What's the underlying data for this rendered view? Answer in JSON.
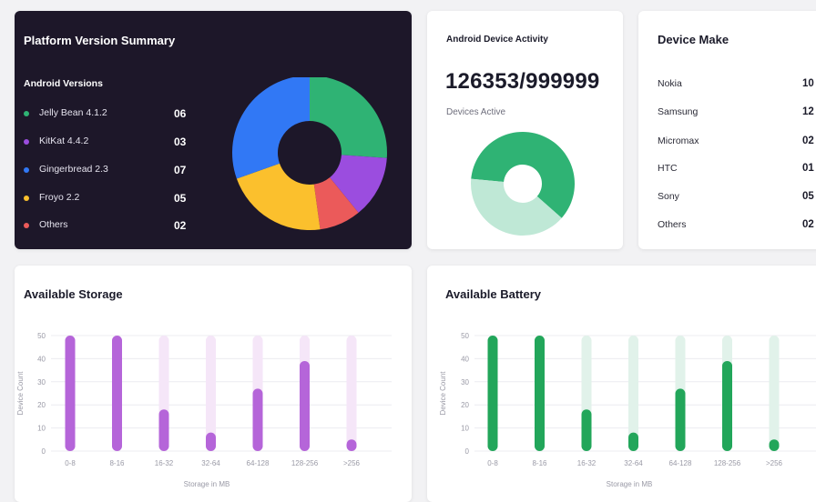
{
  "platform": {
    "title": "Platform Version Summary",
    "subtitle": "Android Versions",
    "items": [
      {
        "label": "Jelly Bean 4.1.2",
        "value": "06",
        "color": "#2fb374"
      },
      {
        "label": "KitKat 4.4.2",
        "value": "03",
        "color": "#9b4ddf"
      },
      {
        "label": "Gingerbread 2.3",
        "value": "07",
        "color": "#3178f5"
      },
      {
        "label": "Froyo 2.2",
        "value": "05",
        "color": "#fbc02d"
      },
      {
        "label": "Others",
        "value": "02",
        "color": "#eb5a5a"
      }
    ]
  },
  "activity": {
    "title": "Android Device Activity",
    "count": "126353/999999",
    "subtitle": "Devices Active",
    "active_fraction": 0.6,
    "colors": {
      "active": "#2fb374",
      "inactive": "#bfe8d6"
    }
  },
  "make": {
    "title": "Device Make",
    "items": [
      {
        "label": "Nokia",
        "value": "10"
      },
      {
        "label": "Samsung",
        "value": "12"
      },
      {
        "label": "Micromax",
        "value": "02"
      },
      {
        "label": "HTC",
        "value": "01"
      },
      {
        "label": "Sony",
        "value": "05"
      },
      {
        "label": "Others",
        "value": "02"
      }
    ]
  },
  "storage": {
    "title": "Available Storage"
  },
  "battery": {
    "title": "Available Battery"
  },
  "chart_data": [
    {
      "type": "bar",
      "title": "Available Storage",
      "xlabel": "Storage in MB",
      "ylabel": "Device Count",
      "ylim": [
        0,
        50
      ],
      "yticks": [
        0,
        10,
        20,
        30,
        40,
        50
      ],
      "categories": [
        "0-8",
        "8-16",
        "16-32",
        "32-64",
        "64-128",
        "128-256",
        ">256"
      ],
      "values": [
        50,
        50,
        18,
        8,
        27,
        39,
        5
      ],
      "colors": {
        "bar": "#b565d9",
        "track": "#f5e6f8"
      }
    },
    {
      "type": "bar",
      "title": "Available Battery",
      "xlabel": "Storage in MB",
      "ylabel": "Device Count",
      "ylim": [
        0,
        50
      ],
      "yticks": [
        0,
        10,
        20,
        30,
        40,
        50
      ],
      "categories": [
        "0-8",
        "8-16",
        "16-32",
        "32-64",
        "64-128",
        "128-256",
        ">256"
      ],
      "values": [
        50,
        50,
        18,
        8,
        27,
        39,
        5
      ],
      "colors": {
        "bar": "#22a65a",
        "track": "#e1f2ea"
      }
    }
  ]
}
